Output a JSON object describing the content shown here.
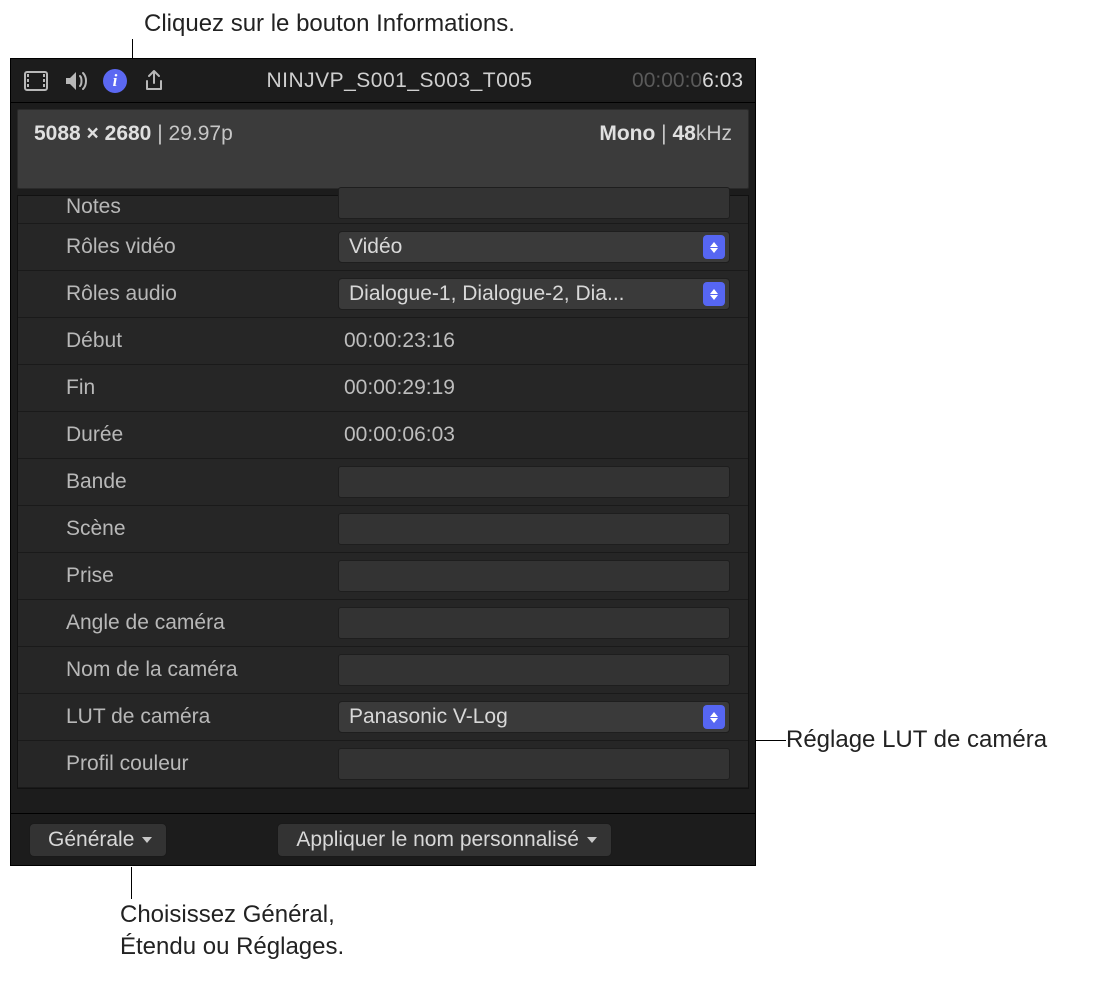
{
  "callouts": {
    "top": "Cliquez sur le bouton Informations.",
    "right": "Réglage LUT de caméra",
    "bottom_line1": "Choisissez Général,",
    "bottom_line2": "Étendu ou Réglages."
  },
  "header": {
    "clip_name": "NINJVP_S001_S003_T005",
    "timecode_dim": "00:00:0",
    "timecode_bright": "6:03",
    "summary_res": "5088 × 2680",
    "summary_fps": "29.97p",
    "summary_audio_mode": "Mono",
    "summary_audio_rate": "48",
    "summary_audio_unit": "kHz"
  },
  "rows": {
    "notes_label": "Notes",
    "video_roles_label": "Rôles vidéo",
    "video_roles_value": "Vidéo",
    "audio_roles_label": "Rôles audio",
    "audio_roles_value": "Dialogue-1, Dialogue-2, Dia...",
    "start_label": "Début",
    "start_value": "00:00:23:16",
    "end_label": "Fin",
    "end_value": "00:00:29:19",
    "duration_label": "Durée",
    "duration_value": "00:00:06:03",
    "reel_label": "Bande",
    "scene_label": "Scène",
    "take_label": "Prise",
    "cam_angle_label": "Angle de caméra",
    "cam_name_label": "Nom de la caméra",
    "cam_lut_label": "LUT de caméra",
    "cam_lut_value": "Panasonic V-Log",
    "color_profile_label": "Profil couleur"
  },
  "bottom": {
    "view_label": "Générale",
    "apply_name_label": "Appliquer le nom personnalisé"
  }
}
